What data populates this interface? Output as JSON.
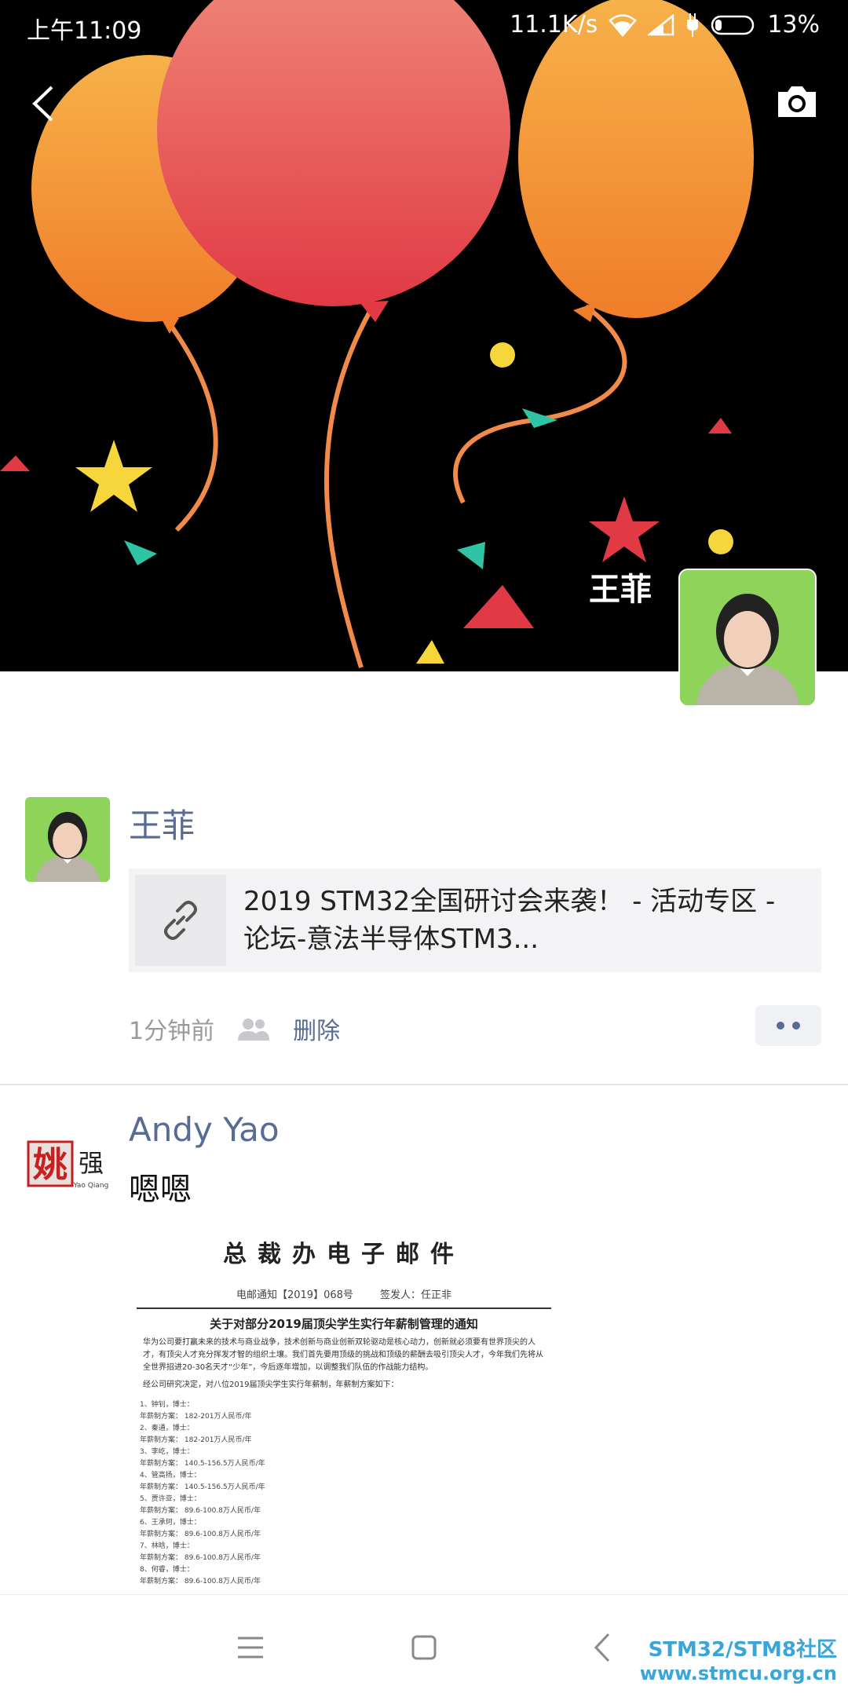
{
  "status_bar": {
    "time": "上午11:09",
    "net_speed": "11.1K/s",
    "battery": "13%"
  },
  "header": {
    "owner_name": "王菲"
  },
  "posts": [
    {
      "author": "王菲",
      "link_title": "2019 STM32全国研讨会来袭！ - 活动专区 - 论坛-意法半导体STM3...",
      "time": "1分钟前",
      "delete_label": "删除"
    },
    {
      "author": "Andy Yao",
      "avatar_char": "姚",
      "avatar_char2": "强",
      "avatar_sub": "Yao Qiang",
      "text": "嗯嗯",
      "document": {
        "heading": "总裁办电子邮件",
        "subline": "电邮通知【2019】068号  签发人：任正非",
        "notice_title": "关于对部分2019届顶尖学生实行年薪制管理的通知",
        "paragraph": "华为公司要打赢未来的技术与商业战争，技术创新与商业创新双轮驱动是核心动力，创新就必须要有世界顶尖的人才，有顶尖人才充分挥发才智的组织土壤。我们首先要用顶级的挑战和顶级的薪酬去吸引顶尖人才，今年我们先将从全世界招进20-30名天才“少年”，今后逐年增加，以调整我们队伍的作战能力结构。",
        "paragraph2": "经公司研究决定，对八位2019届顶尖学生实行年薪制，年薪制方案如下：",
        "list": [
          "1、钟钊，博士：",
          "年薪制方案： 182-201万人民币/年",
          "2、秦通，博士：",
          "年薪制方案： 182-201万人民币/年",
          "3、李屹，博士：",
          "年薪制方案： 140.5-156.5万人民币/年",
          "4、管高扬，博士：",
          "年薪制方案： 140.5-156.5万人民币/年",
          "5、贾许亚，博士：",
          "年薪制方案： 89.6-100.8万人民币/年",
          "6、王承珂，博士：",
          "年薪制方案： 89.6-100.8万人民币/年",
          "7、林晗，博士：",
          "年薪制方案： 89.6-100.8万人民币/年",
          "8、何睿，博士：",
          "年薪制方案： 89.6-100.8万人民币/年"
        ]
      }
    }
  ],
  "watermark": {
    "line1": "STM32/STM8社区",
    "line2": "www.stmcu.org.cn"
  },
  "icons": {
    "back": "back-chevron-icon",
    "camera": "camera-icon",
    "link": "link-icon",
    "friends": "friends-visibility-icon",
    "more": "more-dots-icon",
    "menu": "menu-lines-icon",
    "home": "home-square-icon",
    "nav_back": "nav-back-icon"
  },
  "colors": {
    "link_name": "#576b95",
    "cover_bg": "#000000",
    "watermark": "#3aa5d8"
  }
}
